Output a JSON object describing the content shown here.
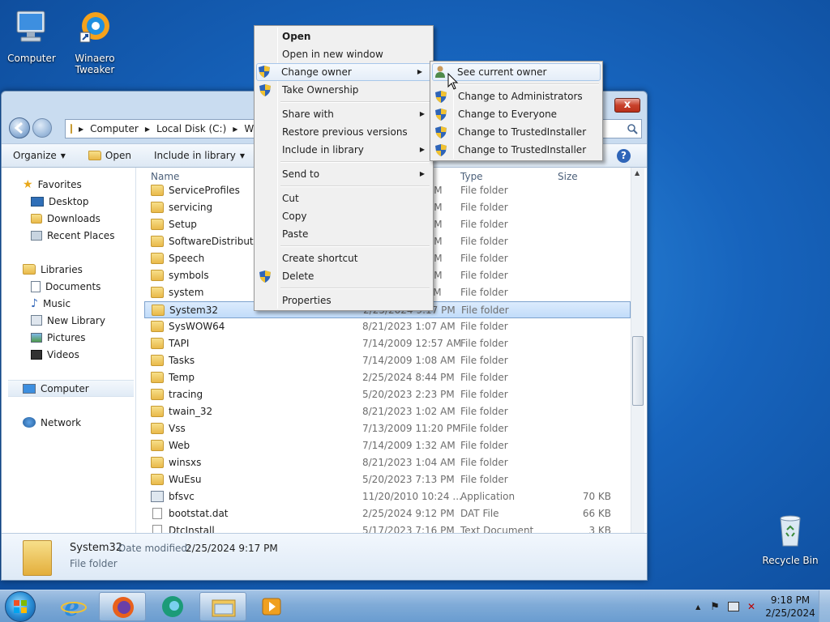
{
  "desktop": {
    "icons": [
      {
        "label": "Computer"
      },
      {
        "label_line1": "Winaero",
        "label_line2": "Tweaker"
      },
      {
        "label": "Recycle Bin"
      }
    ]
  },
  "explorer": {
    "address": {
      "crumb1": "Computer",
      "crumb2": "Local Disk (C:)",
      "crumb3": "Win"
    },
    "toolbar": {
      "organize": "Organize",
      "open": "Open",
      "include": "Include in library"
    },
    "help": "?",
    "close": "x",
    "nav": {
      "favorites": "Favorites",
      "desktop": "Desktop",
      "downloads": "Downloads",
      "recent": "Recent Places",
      "libraries": "Libraries",
      "documents": "Documents",
      "music": "Music",
      "newlib": "New Library",
      "pictures": "Pictures",
      "videos": "Videos",
      "computer": "Computer",
      "network": "Network"
    },
    "columns": {
      "name": "Name",
      "type": "Type",
      "size": "Size"
    },
    "rows": [
      {
        "name": "ServiceProfiles",
        "date": "",
        "date_tail": "AM",
        "type": "File folder",
        "size": "",
        "kind": "folder"
      },
      {
        "name": "servicing",
        "date": "",
        "date_tail": "AM",
        "type": "File folder",
        "size": "",
        "kind": "folder"
      },
      {
        "name": "Setup",
        "date": "",
        "date_tail": "AM",
        "type": "File folder",
        "size": "",
        "kind": "folder"
      },
      {
        "name": "SoftwareDistribution",
        "date": "",
        "date_tail": "AM",
        "type": "File folder",
        "size": "",
        "kind": "folder"
      },
      {
        "name": "Speech",
        "date": "",
        "date_tail": "AM",
        "type": "File folder",
        "size": "",
        "kind": "folder"
      },
      {
        "name": "symbols",
        "date": "",
        "date_tail": "AM",
        "type": "File folder",
        "size": "",
        "kind": "folder"
      },
      {
        "name": "system",
        "date": "",
        "date_tail": "PM",
        "type": "File folder",
        "size": "",
        "kind": "folder"
      },
      {
        "name": "System32",
        "date": "2/25/2024 9:17 PM",
        "date_tail": "",
        "type": "File folder",
        "size": "",
        "kind": "folder",
        "selected": true
      },
      {
        "name": "SysWOW64",
        "date": "8/21/2023 1:07 AM",
        "type": "File folder",
        "size": "",
        "kind": "folder"
      },
      {
        "name": "TAPI",
        "date": "7/14/2009 12:57 AM",
        "type": "File folder",
        "size": "",
        "kind": "folder"
      },
      {
        "name": "Tasks",
        "date": "7/14/2009 1:08 AM",
        "type": "File folder",
        "size": "",
        "kind": "folder"
      },
      {
        "name": "Temp",
        "date": "2/25/2024 8:44 PM",
        "type": "File folder",
        "size": "",
        "kind": "folder"
      },
      {
        "name": "tracing",
        "date": "5/20/2023 2:23 PM",
        "type": "File folder",
        "size": "",
        "kind": "folder"
      },
      {
        "name": "twain_32",
        "date": "8/21/2023 1:02 AM",
        "type": "File folder",
        "size": "",
        "kind": "folder"
      },
      {
        "name": "Vss",
        "date": "7/13/2009 11:20 PM",
        "type": "File folder",
        "size": "",
        "kind": "folder"
      },
      {
        "name": "Web",
        "date": "7/14/2009 1:32 AM",
        "type": "File folder",
        "size": "",
        "kind": "folder"
      },
      {
        "name": "winsxs",
        "date": "8/21/2023 1:04 AM",
        "type": "File folder",
        "size": "",
        "kind": "folder"
      },
      {
        "name": "WuEsu",
        "date": "5/20/2023 7:13 PM",
        "type": "File folder",
        "size": "",
        "kind": "folder"
      },
      {
        "name": "bfsvc",
        "date": "11/20/2010 10:24 ...",
        "type": "Application",
        "size": "70 KB",
        "kind": "app"
      },
      {
        "name": "bootstat.dat",
        "date": "2/25/2024 9:12 PM",
        "type": "DAT File",
        "size": "66 KB",
        "kind": "doc"
      },
      {
        "name": "DtcInstall",
        "date": "5/17/2023 7:16 PM",
        "type": "Text Document",
        "size": "3 KB",
        "kind": "doc"
      }
    ],
    "details": {
      "name": "System32",
      "date_label": "Date modified:",
      "date": "2/25/2024 9:17 PM",
      "type": "File folder"
    }
  },
  "context_menu": {
    "items": {
      "open": "Open",
      "open_new": "Open in new window",
      "change_owner": "Change owner",
      "take_ownership": "Take Ownership",
      "share": "Share with",
      "restore": "Restore previous versions",
      "include": "Include in library",
      "send_to": "Send to",
      "cut": "Cut",
      "copy": "Copy",
      "paste": "Paste",
      "shortcut": "Create shortcut",
      "delete": "Delete",
      "properties": "Properties"
    },
    "arrow": "▶"
  },
  "submenu": {
    "see_owner": "See current owner",
    "to_admins": "Change to Administrators",
    "to_everyone": "Change to Everyone",
    "to_trusted1": "Change to TrustedInstaller",
    "to_trusted2": "Change to TrustedInstaller"
  },
  "taskbar": {
    "time": "9:18 PM",
    "date": "2/25/2024"
  },
  "colors": {
    "accent": "#1764bd",
    "selection": "#c1dcfa",
    "shield_blue": "#2f65b8",
    "shield_yellow": "#f2c230"
  }
}
